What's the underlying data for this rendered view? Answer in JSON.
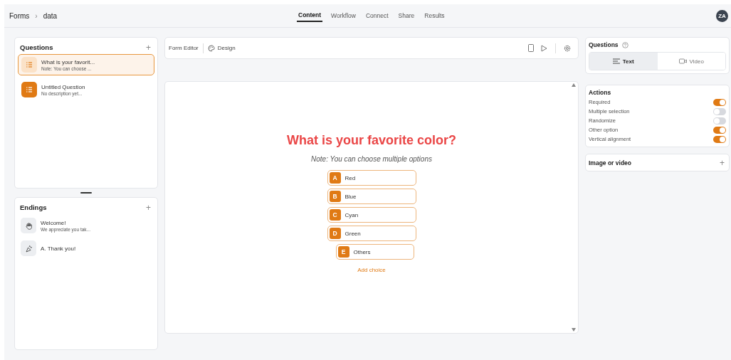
{
  "breadcrumb": {
    "root": "Forms",
    "separator": "›",
    "current": "data"
  },
  "nav_tabs": [
    {
      "label": "Content",
      "selected": true
    },
    {
      "label": "Workflow",
      "selected": false
    },
    {
      "label": "Connect",
      "selected": false
    },
    {
      "label": "Share",
      "selected": false
    },
    {
      "label": "Results",
      "selected": false
    }
  ],
  "avatar": "ZA",
  "questions_panel": {
    "title": "Questions",
    "add": "+",
    "items": [
      {
        "title": "What is your favorit...",
        "subtitle": "Note: You can choose ...",
        "selected": true
      },
      {
        "title": "Untitled Question",
        "subtitle": "No description yet...",
        "selected": false
      }
    ]
  },
  "endings_panel": {
    "title": "Endings",
    "add": "+",
    "items": [
      {
        "kind": "hand",
        "title": "Welcome!",
        "subtitle": "We appreciate you tak..."
      },
      {
        "kind": "party",
        "title": "A. Thank you!"
      }
    ]
  },
  "editor_toolbar": {
    "tabs": [
      {
        "label": "Form Editor",
        "selected": false
      },
      {
        "label": "Design",
        "selected": false
      }
    ]
  },
  "preview": {
    "question": "What is your favorite color?",
    "note": "Note: You can choose multiple options",
    "choices": [
      {
        "kind": "choice",
        "letter": "A",
        "label": "Red"
      },
      {
        "kind": "choice",
        "letter": "B",
        "label": "Blue"
      },
      {
        "kind": "choice",
        "letter": "C",
        "label": "Cyan"
      },
      {
        "kind": "choice",
        "letter": "D",
        "label": "Green"
      },
      {
        "kind": "other",
        "letter": "E",
        "label": "Others"
      }
    ],
    "add_choice": "Add choice"
  },
  "settings": {
    "title": "Questions",
    "modes": [
      {
        "kind": "text",
        "label": "Text",
        "selected": true
      },
      {
        "kind": "video",
        "label": "Video",
        "selected": false
      }
    ],
    "actions_title": "Actions",
    "actions": [
      {
        "label": "Required",
        "on": true
      },
      {
        "label": "Multiple selection",
        "on": false
      },
      {
        "label": "Randomize",
        "on": false
      },
      {
        "label": "Other option",
        "on": true
      },
      {
        "label": "Vertical alignment",
        "on": true
      }
    ],
    "media_title": "Image or video",
    "media_add": "+"
  }
}
